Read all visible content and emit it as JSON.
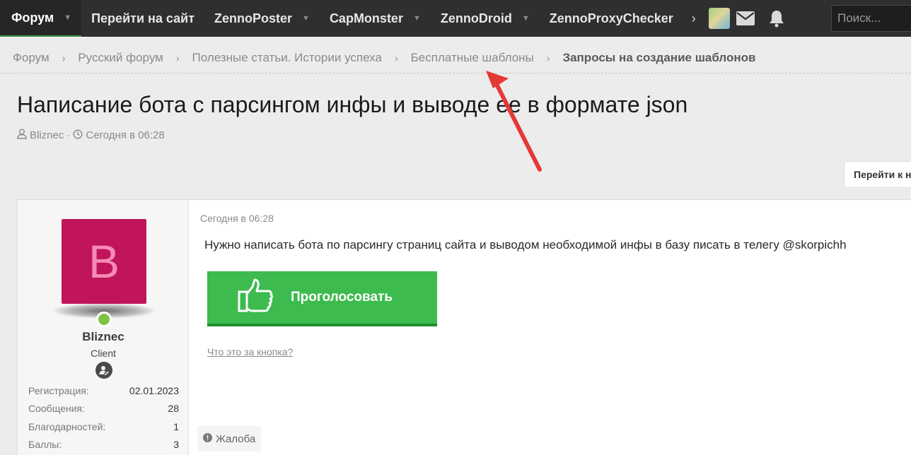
{
  "nav": {
    "items": [
      {
        "label": "Форум"
      },
      {
        "label": "Перейти на сайт"
      },
      {
        "label": "ZennoPoster"
      },
      {
        "label": "CapMonster"
      },
      {
        "label": "ZennoDroid"
      },
      {
        "label": "ZennoProxyChecker"
      }
    ],
    "more_glyph": "›",
    "search_placeholder": "Поиск..."
  },
  "breadcrumb": {
    "items": [
      {
        "label": "Форум"
      },
      {
        "label": "Русский форум"
      },
      {
        "label": "Полезные статьи. Истории успеха"
      },
      {
        "label": "Бесплатные шаблоны"
      },
      {
        "label": "Запросы на создание шаблонов"
      }
    ],
    "separator": "›"
  },
  "thread": {
    "title": "Написание бота с парсингом инфы и выводе ее в формате json",
    "author": "Bliznec",
    "date": "Сегодня в 06:28",
    "goto_label": "Перейти к н"
  },
  "post": {
    "user": {
      "avatar_letter": "B",
      "avatar_color": "#c0155a",
      "name": "Bliznec",
      "role": "Client",
      "stats": [
        {
          "label": "Регистрация:",
          "value": "02.01.2023"
        },
        {
          "label": "Сообщения:",
          "value": "28"
        },
        {
          "label": "Благодарностей:",
          "value": "1"
        },
        {
          "label": "Баллы:",
          "value": "3"
        }
      ]
    },
    "date": "Сегодня в 06:28",
    "text": "Нужно написать бота по парсингу страниц сайта и выводом необходимой инфы в базу писать в телегу @skorpichh",
    "vote_label": "Проголосовать",
    "what_link": "Что это за кнопка?",
    "report_label": "Жалоба"
  },
  "colors": {
    "nav_bg": "#2f2f2f",
    "vote_green": "#3dbb4e",
    "online_green": "#7fc142",
    "annotation_arrow": "#e53935"
  }
}
